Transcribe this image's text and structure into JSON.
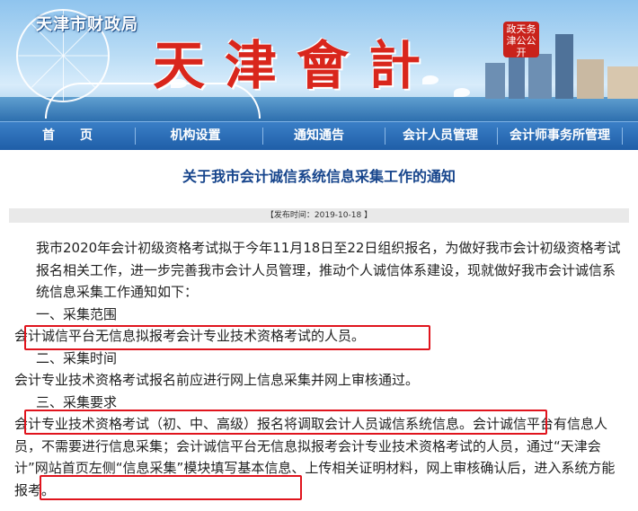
{
  "header": {
    "department": "天津市财政局",
    "site_title": "天津會計",
    "seal_text": "政天务津公公开"
  },
  "nav": {
    "items": [
      "首　　页",
      "机构设置",
      "通知通告",
      "会计人员管理",
      "会计师事务所管理"
    ]
  },
  "article": {
    "title": "关于我市会计诚信系统信息采集工作的通知",
    "publish_time": "【发布时间：2019-10-18 】",
    "paragraphs": [
      "我市2020年会计初级资格考试拟于今年11月18日至22日组织报名，为做好我市会计初级资格考试报名相关工作，进一步完善我市会计人员管理，推动个人诚信体系建设，现就做好我市会计诚信系统信息采集工作通知如下：",
      "一、采集范围",
      "会计诚信平台无信息拟报考会计专业技术资格考试的人员。",
      "二、采集时间",
      "会计专业技术资格考试报名前应进行网上信息采集并网上审核通过。",
      "三、采集要求",
      "会计专业技术资格考试（初、中、高级）报名将调取会计人员诚信系统信息。会计诚信平台有信息人员，不需要进行信息采集；会计诚信平台无信息拟报考会计专业技术资格考试的人员，通过“天津会计”网站首页左侧“信息采集”模块填写基本信息、上传相关证明材料，网上审核确认后，进入系统方能报考。"
    ]
  }
}
